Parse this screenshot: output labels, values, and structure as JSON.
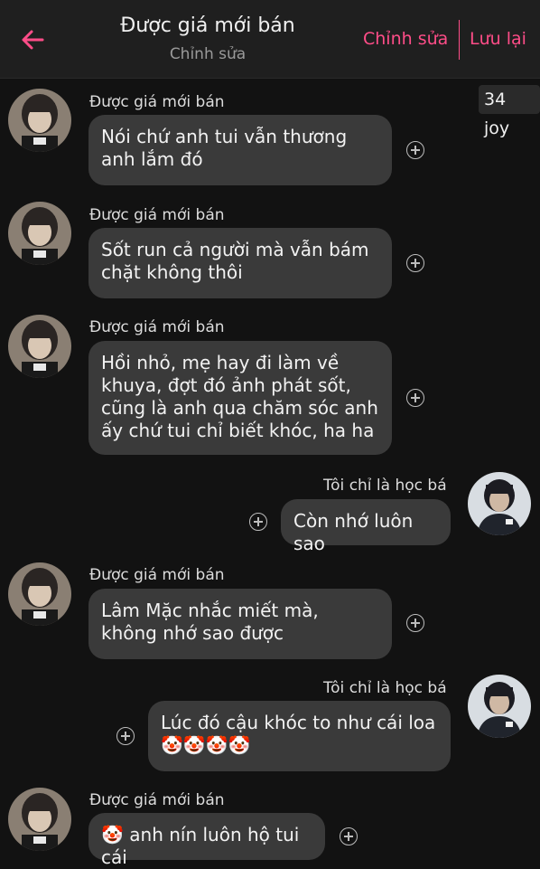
{
  "header": {
    "title": "Được giá mới bán",
    "subtitle": "Chỉnh sửa",
    "edit_label": "Chỉnh sửa",
    "save_label": "Lưu lại"
  },
  "joy_badge": "34 joy",
  "colors": {
    "accent": "#ff4d88",
    "bubble": "#3a3a3a",
    "background": "#121212"
  },
  "messages": [
    {
      "sender": "Được giá mới bán",
      "side": "left",
      "text": "Nói chứ anh tui vẫn thương anh lắm đó"
    },
    {
      "sender": "Được giá mới bán",
      "side": "left",
      "text": "Sốt run cả người mà vẫn bám chặt không thôi"
    },
    {
      "sender": "Được giá mới bán",
      "side": "left",
      "text": "Hồi nhỏ, mẹ hay đi làm về khuya, đợt đó ảnh phát sốt, cũng là anh qua chăm sóc anh ấy chứ tui chỉ biết khóc, ha ha"
    },
    {
      "sender": "Tôi chỉ là học bá",
      "side": "right",
      "text": "Còn nhớ luôn sao"
    },
    {
      "sender": "Được giá mới bán",
      "side": "left",
      "text": "Lâm Mặc nhắc miết mà, không nhớ sao được"
    },
    {
      "sender": "Tôi chỉ là học bá",
      "side": "right",
      "text": "Lúc đó cậu khóc to như cái loa",
      "emoji_line": "🤡🤡🤡🤡"
    },
    {
      "sender": "Được giá mới bán",
      "side": "left",
      "text": "anh nín luôn hộ tui cái",
      "emoji_prefix": "🤡"
    }
  ]
}
